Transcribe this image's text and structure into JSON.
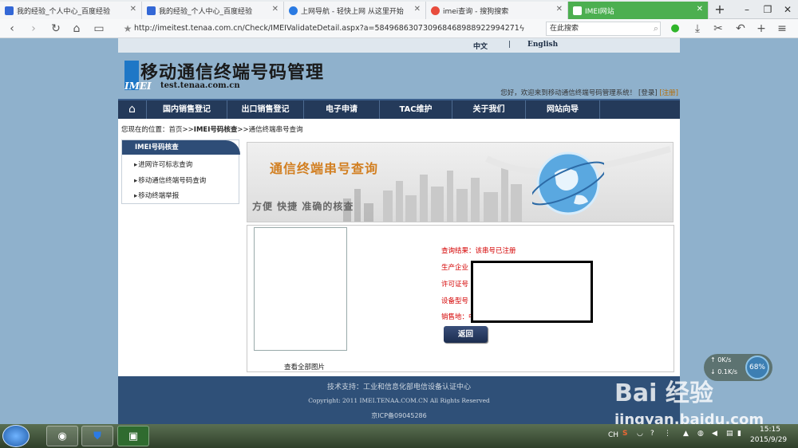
{
  "browser": {
    "tabs": [
      {
        "label": "我的经验_个人中心_百度经验",
        "fav_color": "#3367d6"
      },
      {
        "label": "我的经验_个人中心_百度经验",
        "fav_color": "#3367d6"
      },
      {
        "label": "上网导航 - 轻快上网 从这里开始",
        "fav_color": "#2a7ae2"
      },
      {
        "label": "imei查询 - 搜狗搜索",
        "fav_color": "#e84c3d"
      },
      {
        "label": "IMEI网站",
        "fav_color": "#ffffff"
      }
    ],
    "new_tab": "+",
    "url": "http://imeitest.tenaa.com.cn/Check/IMEIValidateDetail.aspx?a=584968630730968468988922994271",
    "search_placeholder": "在此搜索"
  },
  "site": {
    "lang_cn": "中文",
    "lang_sep": "|",
    "lang_en": "English",
    "logo_title": "移动通信终端号码管理",
    "logo_mark": "IMEI",
    "logo_url": "test.tenaa.com.cn",
    "welcome": "您好，欢迎来到移动通信终端号码管理系统！",
    "login": "[登录]",
    "register": "[注册]",
    "nav": [
      "国内销售登记",
      "出口销售登记",
      "电子申请",
      "TAC维护",
      "关于我们",
      "网站向导"
    ],
    "crumb_label": "您现在的位置：",
    "crumb_home": "首页",
    "crumb_sep1": ">>",
    "crumb_section": "IMEI号码核查",
    "crumb_sep2": ">>",
    "crumb_page": "通信终端串号查询",
    "side_title": "IMEI号码核查",
    "side_items": [
      "进网许可标志查询",
      "移动通信终端号码查询",
      "移动终端举报"
    ],
    "banner_title": "通信终端串号查询",
    "banner_sub": "方便 快捷 准确的核查",
    "result_status": "查询结果：该串号已注册",
    "result_maker": "生产企业",
    "result_license": "许可证号",
    "result_model": "设备型号",
    "result_area": "销售地：中",
    "back_label": "返回",
    "photo_link": "查看全部图片",
    "footer_support": "技术支持：工业和信息化部电信设备认证中心",
    "footer_copy": "Copyright:   2011   IMEI.TENAA.COM.CN  All Rights Reserved",
    "footer_icp": "京ICP备09045286"
  },
  "overlay": {
    "speed_up": "0K/s",
    "speed_down": "0.1K/s",
    "speed_pct": "68%",
    "watermark": "Bai 经验",
    "watermark_url": "jingyan.baidu.com"
  },
  "taskbar": {
    "lang": "CH",
    "time": "15:15",
    "date": "2015/9/29"
  }
}
